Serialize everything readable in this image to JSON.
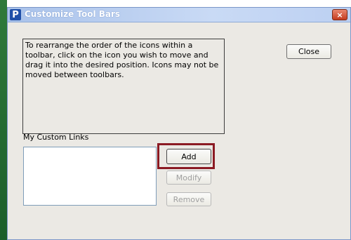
{
  "window": {
    "app_icon_letter": "P",
    "title": "Customize Tool Bars",
    "close_glyph": "×"
  },
  "instructions": {
    "text": "To rearrange the order of the icons within a toolbar, click on the icon you wish to move and drag it into the desired position. Icons may not be moved between toolbars."
  },
  "buttons": {
    "close_label": "Close",
    "add_label": "Add",
    "modify_label": "Modify",
    "remove_label": "Remove"
  },
  "custom_links": {
    "label": "My Custom Links",
    "items": []
  },
  "icons": {
    "app": "app-logo-icon",
    "window_close": "window-close-icon"
  },
  "colors": {
    "titlebar": "#a9c2ea",
    "close_button": "#c43b1f",
    "highlight": "#8b1a23",
    "dialog_bg": "#ebe9e4"
  }
}
